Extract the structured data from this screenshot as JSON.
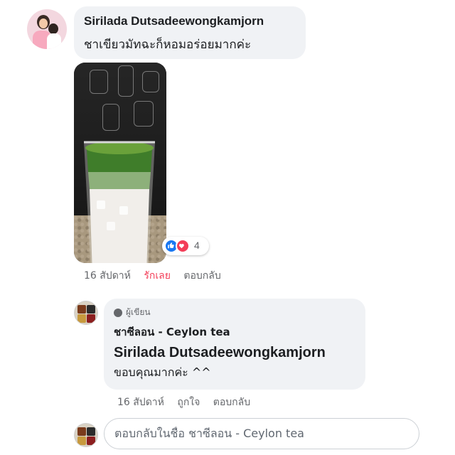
{
  "comment": {
    "author": "Sirilada Dutsadeewongkamjorn",
    "text": "ชาเขียวมัทฉะก็หอมอร่อยมากค่ะ",
    "reactions": {
      "icons": [
        "like-icon",
        "love-icon"
      ],
      "count": "4"
    },
    "actions": {
      "time": "16 สัปดาห์",
      "reaction": "รักเลย",
      "reply": "ตอบกลับ"
    }
  },
  "reply": {
    "badge": "ผู้เขียน",
    "author": "ชาซีลอน - Ceylon tea",
    "mention": "Sirilada Dutsadeewongkamjorn",
    "text": "ขอบคุณมากค่ะ ^^",
    "actions": {
      "time": "16 สัปดาห์",
      "like": "ถูกใจ",
      "reply": "ตอบกลับ"
    }
  },
  "reply_box": {
    "placeholder": "ตอบกลับในชื่อ ชาซีลอน - Ceylon tea"
  },
  "colors": {
    "like": "#1877f2",
    "love": "#f33e58",
    "bubble": "#f0f2f5",
    "meta": "#65676b"
  }
}
